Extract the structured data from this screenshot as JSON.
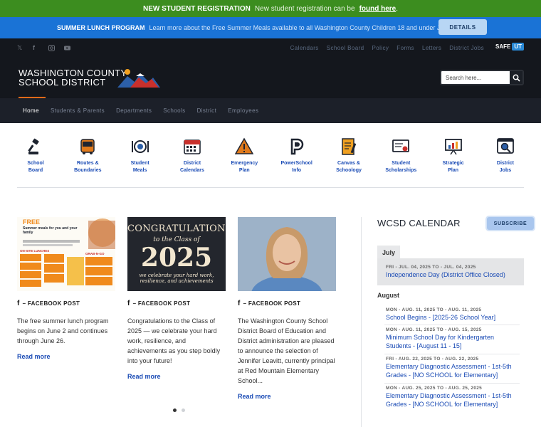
{
  "top_banner": {
    "title": "NEW STUDENT REGISTRATION",
    "message": "New student registration can be",
    "link": "found here",
    "suffix": "."
  },
  "alert": {
    "title": "SUMMER LUNCH PROGRAM",
    "text": "Learn more about the Free Summer Meals available to all Washington County Children 18 and under June 2 - 26",
    "button": "DETAILS"
  },
  "social": {
    "icons": [
      "x-icon",
      "facebook-icon",
      "instagram-icon",
      "youtube-icon"
    ]
  },
  "util_nav": [
    "Calendars",
    "School Board",
    "Policy",
    "Forms",
    "Letters",
    "District Jobs"
  ],
  "safe_ut": {
    "safe": "SAFE",
    "ut": "UT"
  },
  "logo": {
    "line1": "WASHINGTON COUNTY",
    "line2": "SCHOOL DISTRICT"
  },
  "search": {
    "placeholder": "Search here..."
  },
  "main_nav": [
    "Home",
    "Students & Parents",
    "Departments",
    "Schools",
    "District",
    "Employees"
  ],
  "quick_links": [
    {
      "l1": "School",
      "l2": "Board",
      "icon": "gavel-icon"
    },
    {
      "l1": "Routes &",
      "l2": "Boundaries",
      "icon": "bus-icon"
    },
    {
      "l1": "Student",
      "l2": "Meals",
      "icon": "plate-icon"
    },
    {
      "l1": "District",
      "l2": "Calendars",
      "icon": "calendar-icon"
    },
    {
      "l1": "Emergency",
      "l2": "Plan",
      "icon": "warning-icon"
    },
    {
      "l1": "PowerSchool",
      "l2": "Info",
      "icon": "powerschool-icon"
    },
    {
      "l1": "Canvas &",
      "l2": "Schoology",
      "icon": "document-pen-icon"
    },
    {
      "l1": "Student",
      "l2": "Scholarships",
      "icon": "certificate-icon"
    },
    {
      "l1": "Strategic",
      "l2": "Plan",
      "icon": "presentation-icon"
    },
    {
      "l1": "District",
      "l2": "Jobs",
      "icon": "job-search-icon"
    }
  ],
  "cards": [
    {
      "source": "– FACEBOOK POST",
      "body": "The free summer lunch program begins on June 2 and continues through June 26.",
      "more": "Read more"
    },
    {
      "source": "– FACEBOOK POST",
      "body": "Congratulations to the Class of 2025 — we celebrate your hard work, resilience, and achievements as you step boldly into your future!",
      "more": "Read more",
      "img_line1": "CONGRATULATIONS",
      "img_line2": "to the Class of",
      "img_line3": "2025",
      "img_line4": "we celebrate your hard work,",
      "img_line5": "resilience, and achievements"
    },
    {
      "source": "– FACEBOOK POST",
      "body": "The Washington County School District Board of Education and District administration are pleased to announce the selection of Jennifer Leavitt, currently principal at Red Mountain Elementary School...",
      "more": "Read more"
    }
  ],
  "flyer": {
    "free": "FREE",
    "headline": "Summer meals for you and your family",
    "onsite": "ON-SITE LUNCHES",
    "grab": "GRAB-N-GO"
  },
  "calendar": {
    "title": "WCSD CALENDAR",
    "subscribe": "SUBSCRIBE",
    "july": "July",
    "july_event": {
      "date": "FRI - JUL. 04, 2025 TO - JUL. 04, 2025",
      "title": "Independence Day (District Office Closed)"
    },
    "august": "August",
    "events": [
      {
        "date": "MON - AUG. 11, 2025 TO - AUG. 11, 2025",
        "title": "School Begins - [2025-26 School Year]"
      },
      {
        "date": "MON - AUG. 11, 2025 TO - AUG. 15, 2025",
        "title": "Minimum School Day for Kindergarten Students - [August 11 - 15]"
      },
      {
        "date": "FRI - AUG. 22, 2025 TO - AUG. 22, 2025",
        "title": "Elementary Diagnostic Assessment - 1st-5th Grades - [NO SCHOOL for Elementary]"
      },
      {
        "date": "MON - AUG. 25, 2025 TO - AUG. 25, 2025",
        "title": "Elementary Diagnostic Assessment - 1st-5th Grades - [NO SCHOOL for Elementary]"
      }
    ]
  }
}
